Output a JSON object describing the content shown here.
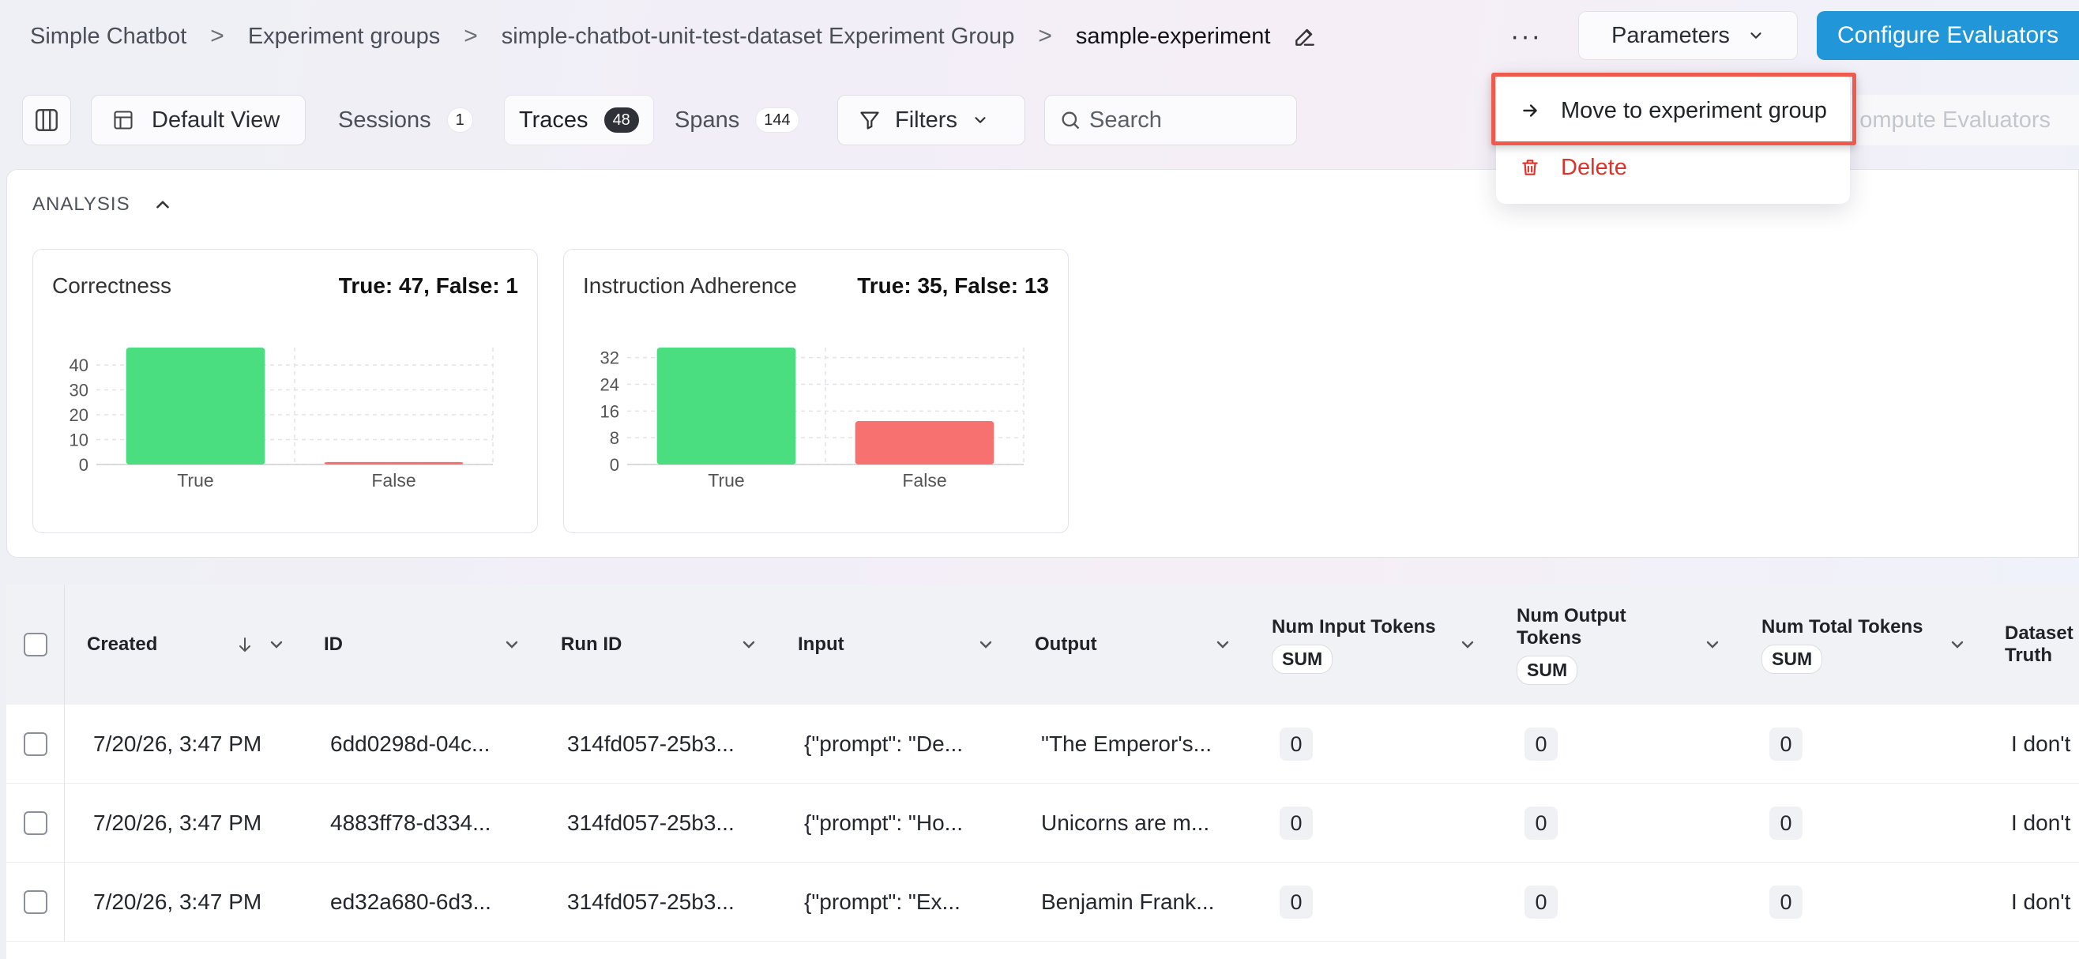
{
  "breadcrumb": {
    "items": [
      "Simple Chatbot",
      "Experiment groups",
      "simple-chatbot-unit-test-dataset Experiment Group"
    ],
    "current": "sample-experiment",
    "separator": ">"
  },
  "header": {
    "more_label": "···",
    "parameters_label": "Parameters",
    "configure_label": "Configure Evaluators"
  },
  "toolbar": {
    "view_label": "Default View",
    "tabs": [
      {
        "label": "Sessions",
        "count": "1"
      },
      {
        "label": "Traces",
        "count": "48"
      },
      {
        "label": "Spans",
        "count": "144"
      }
    ],
    "filters_label": "Filters",
    "search_placeholder": "Search",
    "recompute_label": "ompute Evaluators"
  },
  "menu": {
    "move_label": "Move to experiment group",
    "delete_label": "Delete"
  },
  "analysis": {
    "title": "ANALYSIS"
  },
  "chart_data": [
    {
      "type": "bar",
      "title": "Correctness",
      "summary": "True: 47, False: 1",
      "categories": [
        "True",
        "False"
      ],
      "values": [
        47,
        1
      ],
      "yticks": [
        0,
        10,
        20,
        30,
        40
      ],
      "ylim": [
        0,
        47
      ],
      "colors": [
        "#4ade80",
        "#f87171"
      ]
    },
    {
      "type": "bar",
      "title": "Instruction Adherence",
      "summary": "True: 35, False: 13",
      "categories": [
        "True",
        "False"
      ],
      "values": [
        35,
        13
      ],
      "yticks": [
        0,
        8,
        16,
        24,
        32
      ],
      "ylim": [
        0,
        35
      ],
      "colors": [
        "#4ade80",
        "#f87171"
      ]
    }
  ],
  "table": {
    "columns": [
      {
        "label": "Created"
      },
      {
        "label": "ID"
      },
      {
        "label": "Run ID"
      },
      {
        "label": "Input"
      },
      {
        "label": "Output"
      },
      {
        "label": "Num Input Tokens",
        "chip": "SUM"
      },
      {
        "label": "Num Output Tokens",
        "chip": "SUM"
      },
      {
        "label": "Num Total Tokens",
        "chip": "SUM"
      },
      {
        "label": "Dataset Truth"
      }
    ],
    "rows": [
      {
        "created": "7/20/26, 3:47 PM",
        "id": "6dd0298d-04c...",
        "run_id": "314fd057-25b3...",
        "input": "{\"prompt\": \"De...",
        "output": "\"The Emperor's...",
        "in_tokens": "0",
        "out_tokens": "0",
        "total_tokens": "0",
        "truth": "I don't"
      },
      {
        "created": "7/20/26, 3:47 PM",
        "id": "4883ff78-d334...",
        "run_id": "314fd057-25b3...",
        "input": "{\"prompt\": \"Ho...",
        "output": "Unicorns are m...",
        "in_tokens": "0",
        "out_tokens": "0",
        "total_tokens": "0",
        "truth": "I don't"
      },
      {
        "created": "7/20/26, 3:47 PM",
        "id": "ed32a680-6d3...",
        "run_id": "314fd057-25b3...",
        "input": "{\"prompt\": \"Ex...",
        "output": "Benjamin Frank...",
        "in_tokens": "0",
        "out_tokens": "0",
        "total_tokens": "0",
        "truth": "I don't"
      }
    ]
  }
}
